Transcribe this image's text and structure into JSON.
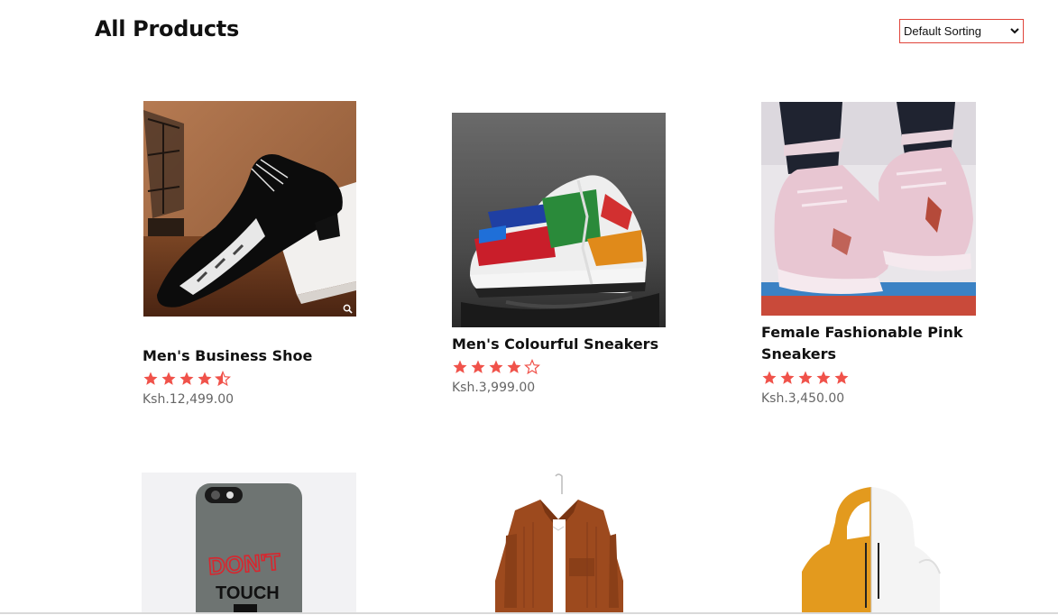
{
  "header": {
    "title": "All Products"
  },
  "sorting": {
    "selected": "Default Sorting"
  },
  "products": [
    {
      "name": "Men's Business Shoe",
      "rating": 4.5,
      "price": "Ksh.12,499.00",
      "image": "black-patent-shoe"
    },
    {
      "name": "Men's Colourful Sneakers",
      "rating": 4,
      "price": "Ksh.3,999.00",
      "image": "colourful-sneaker"
    },
    {
      "name": "Female Fashionable Pink Sneakers",
      "rating": 5,
      "price": "Ksh.3,450.00",
      "image": "pink-sneakers"
    },
    {
      "image": "phone-case"
    },
    {
      "image": "brown-jacket"
    },
    {
      "image": "orange-white-hoodie"
    }
  ],
  "colors": {
    "accent": "#e0443a",
    "star": "#f0524a",
    "price": "#666666"
  },
  "phone_case_text": [
    "DON'T",
    "TOUCH"
  ]
}
